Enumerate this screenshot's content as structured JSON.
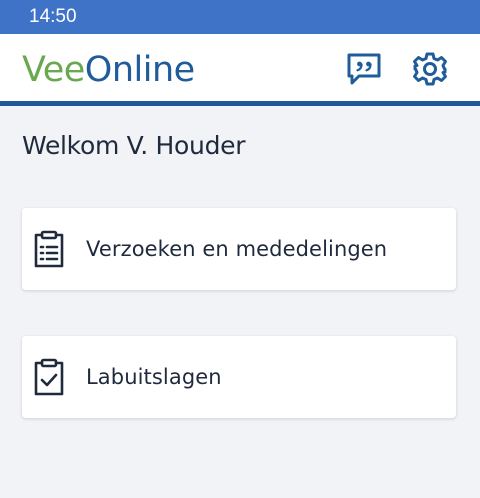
{
  "status_bar": {
    "time": "14:50"
  },
  "app_bar": {
    "logo_part1": "Vee",
    "logo_part2": "Online",
    "feedback_icon": "speech-bubble-quote-icon",
    "settings_icon": "gear-icon"
  },
  "welcome": {
    "text": "Welkom V. Houder"
  },
  "cards": [
    {
      "label": "Verzoeken en mededelingen",
      "icon": "clipboard-list-icon"
    },
    {
      "label": "Labuitslagen",
      "icon": "clipboard-check-icon"
    }
  ],
  "colors": {
    "status_bar": "#3f73c8",
    "brand_green": "#6aa84f",
    "brand_blue": "#1f5c99",
    "divider": "#1e5a9a",
    "icon": "#1f5c99",
    "background": "#f2f3f6"
  }
}
